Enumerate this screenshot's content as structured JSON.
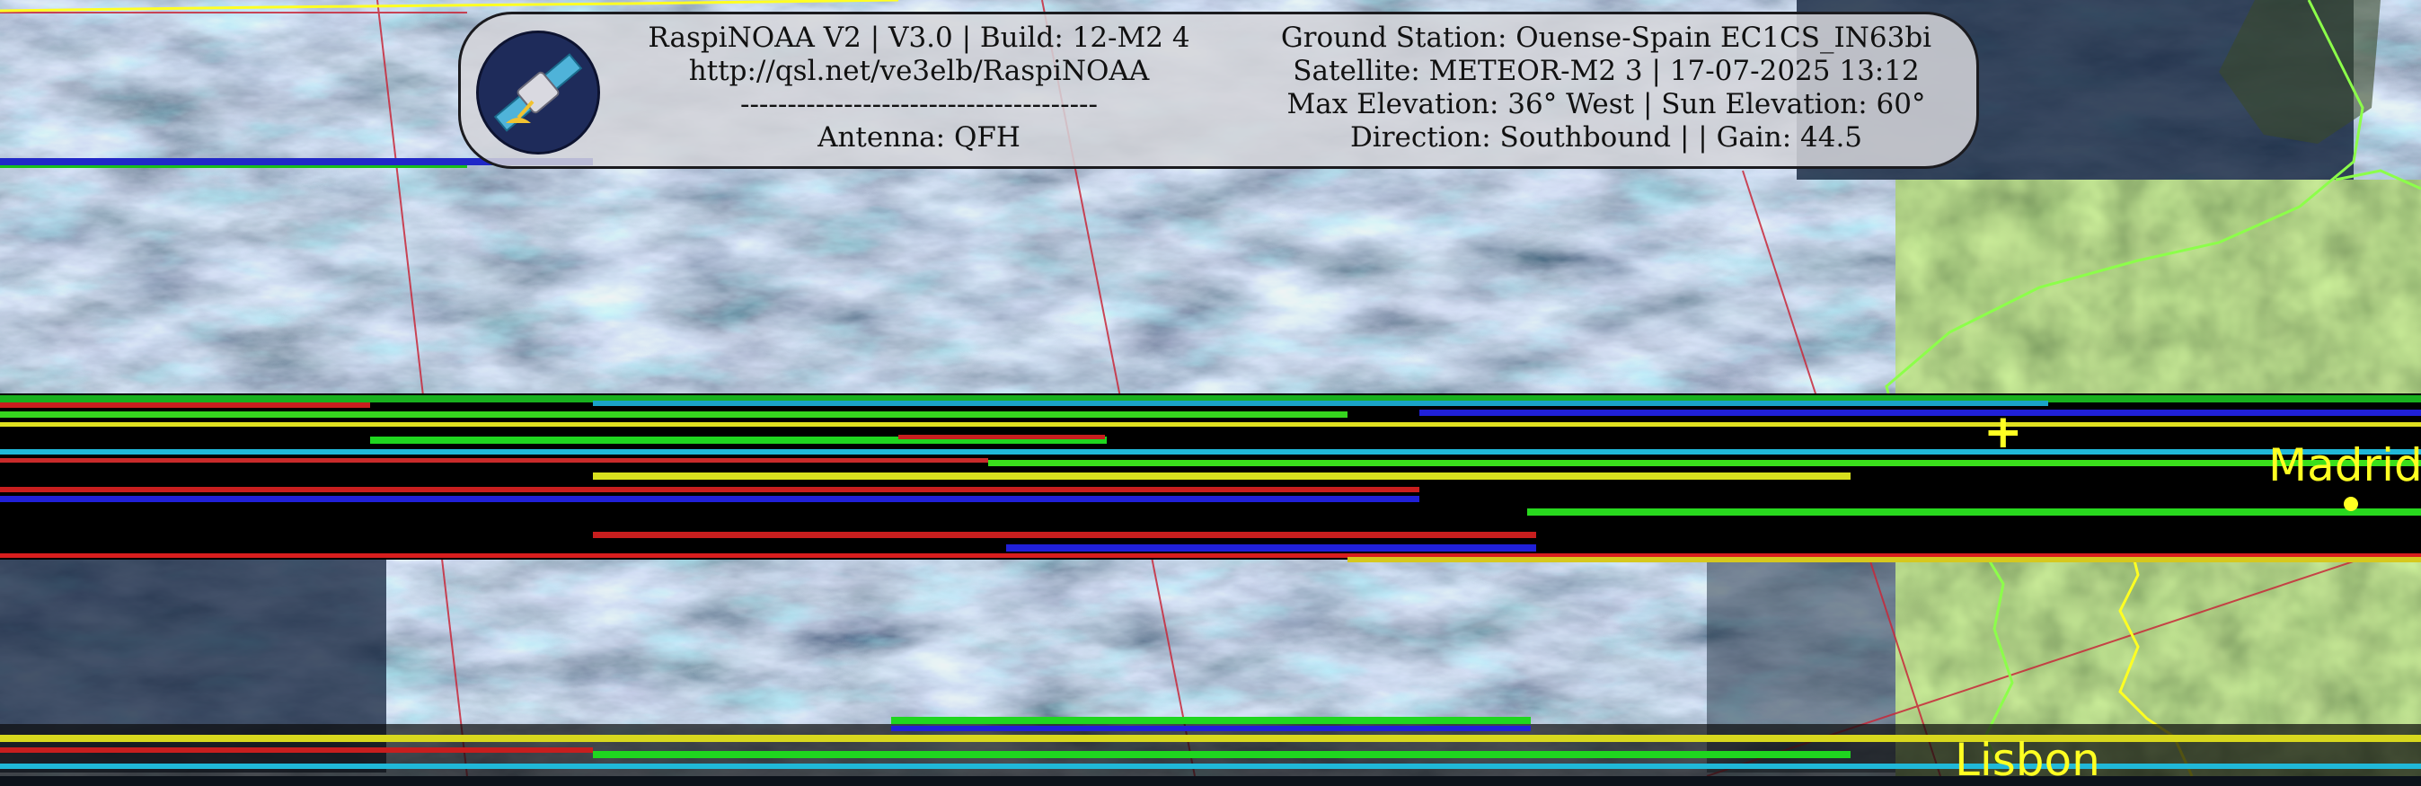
{
  "info_box": {
    "left_lines": [
      "RaspiNOAA V2 | V3.0 | Build: 12-M2 4",
      "http://qsl.net/ve3elb/RaspiNOAA",
      "--------------------------------------",
      "Antenna: QFH"
    ],
    "right_lines": [
      "Ground Station: Ouense-Spain EC1CS_IN63bi",
      "Satellite: METEOR-M2 3 | 17-07-2025 13:12",
      "Max Elevation: 36° West | Sun Elevation: 60°",
      "Direction: Southbound | | Gain: 44.5"
    ],
    "logo_icon": "satellite-icon"
  },
  "map": {
    "cities": [
      {
        "name": "Madrid",
        "marker": "dot"
      },
      {
        "name": "Lisbon",
        "marker": "none"
      }
    ],
    "station_marker": "+",
    "colors": {
      "borders": "#ffff22",
      "coastline": "#8cff4a",
      "graticule": "#c8283a"
    }
  }
}
